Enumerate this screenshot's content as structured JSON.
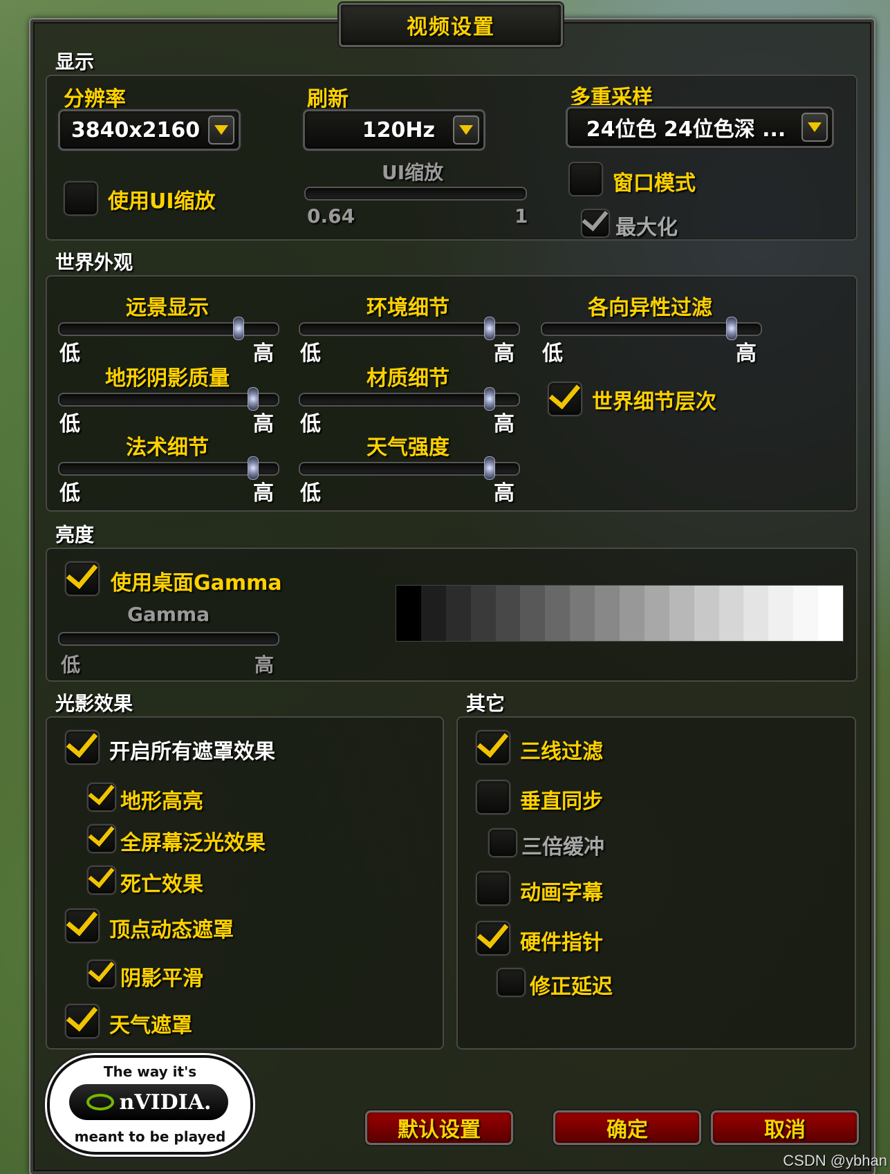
{
  "window_title": "视频设置",
  "display": {
    "section": "显示",
    "resolution_label": "分辨率",
    "resolution_value": "3840x2160",
    "refresh_label": "刷新",
    "refresh_value": "120Hz",
    "multisample_label": "多重采样",
    "multisample_value": "24位色 24位色深 ...",
    "use_ui_scale_label": "使用UI缩放",
    "use_ui_scale_checked": false,
    "ui_scale_label": "UI缩放",
    "ui_scale_min": "0.64",
    "ui_scale_max": "1",
    "window_mode_label": "窗口模式",
    "window_mode_checked": false,
    "maximize_label": "最大化",
    "maximize_checked": true
  },
  "world": {
    "section": "世界外观",
    "low": "低",
    "high": "高",
    "sliders": [
      {
        "label": "远景显示",
        "level": 0.83
      },
      {
        "label": "环境细节",
        "level": 0.88
      },
      {
        "label": "各向异性过滤",
        "level": 0.88
      },
      {
        "label": "地形阴影质量",
        "level": 0.9
      },
      {
        "label": "材质细节",
        "level": 0.88
      },
      {
        "label": "法术细节",
        "level": 0.9
      },
      {
        "label": "天气强度",
        "level": 0.88
      }
    ],
    "world_detail_label": "世界细节层次",
    "world_detail_checked": true
  },
  "brightness": {
    "section": "亮度",
    "use_desktop_gamma_label": "使用桌面Gamma",
    "use_desktop_gamma_checked": true,
    "gamma_label": "Gamma",
    "low": "低",
    "high": "高"
  },
  "lighting": {
    "section": "光影效果",
    "items": [
      {
        "label": "开启所有遮罩效果",
        "checked": true
      },
      {
        "label": "地形高亮",
        "checked": true
      },
      {
        "label": "全屏幕泛光效果",
        "checked": true
      },
      {
        "label": "死亡效果",
        "checked": true
      },
      {
        "label": "顶点动态遮罩",
        "checked": true
      },
      {
        "label": "阴影平滑",
        "checked": true
      },
      {
        "label": "天气遮罩",
        "checked": true
      }
    ]
  },
  "other": {
    "section": "其它",
    "items": [
      {
        "label": "三线过滤",
        "checked": true
      },
      {
        "label": "垂直同步",
        "checked": false
      },
      {
        "label": "三倍缓冲",
        "checked": false
      },
      {
        "label": "动画字幕",
        "checked": false
      },
      {
        "label": "硬件指针",
        "checked": true
      },
      {
        "label": "修正延迟",
        "checked": false
      }
    ]
  },
  "buttons": {
    "default": "默认设置",
    "ok": "确定",
    "cancel": "取消"
  },
  "nvidia_logo": {
    "top": "The way it's",
    "brand": "nVIDIA.",
    "bottom": "meant to be played"
  },
  "watermark": "CSDN @ybhan"
}
